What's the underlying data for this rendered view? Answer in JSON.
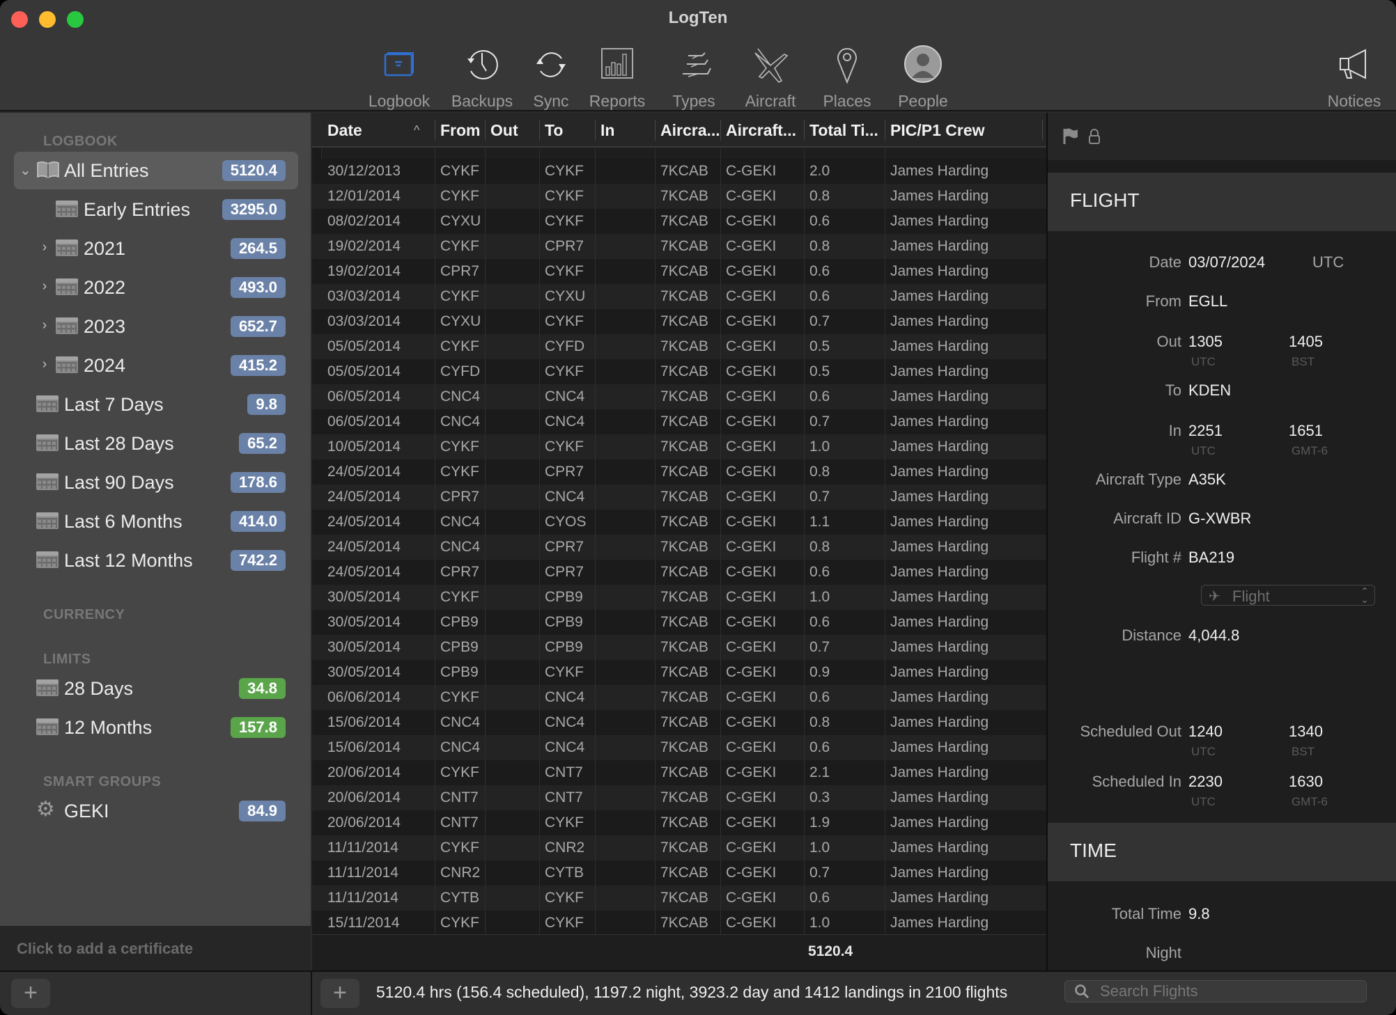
{
  "window": {
    "title": "LogTen"
  },
  "toolbar": {
    "items": [
      {
        "label": "Logbook",
        "icon": "logbook-icon",
        "active": true
      },
      {
        "label": "Backups",
        "icon": "backups-clock-icon"
      },
      {
        "label": "Sync",
        "icon": "sync-icon"
      },
      {
        "label": "Reports",
        "icon": "reports-bar-chart-icon"
      },
      {
        "label": "Types",
        "icon": "types-planes-icon"
      },
      {
        "label": "Aircraft",
        "icon": "aircraft-icon"
      },
      {
        "label": "Places",
        "icon": "places-pin-icon"
      },
      {
        "label": "People",
        "icon": "people-avatar-icon"
      }
    ],
    "notices": {
      "label": "Notices",
      "icon": "megaphone-icon"
    }
  },
  "sidebar": {
    "sections": {
      "logbook": "LOGBOOK",
      "currency": "CURRENCY",
      "limits": "LIMITS",
      "smart_groups": "SMART GROUPS"
    },
    "logbook_items": [
      {
        "label": "All Entries",
        "value": "5120.4",
        "selected": true,
        "expanded": true
      },
      {
        "label": "Early Entries",
        "value": "3295.0"
      },
      {
        "label": "2021",
        "value": "264.5",
        "collapsed": true
      },
      {
        "label": "2022",
        "value": "493.0",
        "collapsed": true
      },
      {
        "label": "2023",
        "value": "652.7",
        "collapsed": true
      },
      {
        "label": "2024",
        "value": "415.2",
        "collapsed": true
      },
      {
        "label": "Last 7 Days",
        "value": "9.8"
      },
      {
        "label": "Last 28 Days",
        "value": "65.2"
      },
      {
        "label": "Last 90 Days",
        "value": "178.6"
      },
      {
        "label": "Last 6 Months",
        "value": "414.0"
      },
      {
        "label": "Last 12 Months",
        "value": "742.2"
      }
    ],
    "limit_items": [
      {
        "label": "28 Days",
        "value": "34.8",
        "status_color": "#5aa54a"
      },
      {
        "label": "12 Months",
        "value": "157.8",
        "status_color": "#5aa54a"
      }
    ],
    "smart_group_items": [
      {
        "label": "GEKI",
        "value": "84.9"
      }
    ],
    "certificate_hint": "Click to add a certificate"
  },
  "table": {
    "columns": [
      "Date",
      "From",
      "Out",
      "To",
      "In",
      "Aircra...",
      "Aircraft...",
      "Total Ti...",
      "PIC/P1 Crew"
    ],
    "sort": {
      "column": "Date",
      "direction": "ascending"
    },
    "rows": [
      [
        "30/12/2013",
        "CYKF",
        "",
        "CYKF",
        "",
        "7KCAB",
        "C-GEKI",
        "2.0",
        "James Harding"
      ],
      [
        "12/01/2014",
        "CYKF",
        "",
        "CYKF",
        "",
        "7KCAB",
        "C-GEKI",
        "0.8",
        "James Harding"
      ],
      [
        "08/02/2014",
        "CYXU",
        "",
        "CYKF",
        "",
        "7KCAB",
        "C-GEKI",
        "0.6",
        "James Harding"
      ],
      [
        "19/02/2014",
        "CYKF",
        "",
        "CPR7",
        "",
        "7KCAB",
        "C-GEKI",
        "0.8",
        "James Harding"
      ],
      [
        "19/02/2014",
        "CPR7",
        "",
        "CYKF",
        "",
        "7KCAB",
        "C-GEKI",
        "0.6",
        "James Harding"
      ],
      [
        "03/03/2014",
        "CYKF",
        "",
        "CYXU",
        "",
        "7KCAB",
        "C-GEKI",
        "0.6",
        "James Harding"
      ],
      [
        "03/03/2014",
        "CYXU",
        "",
        "CYKF",
        "",
        "7KCAB",
        "C-GEKI",
        "0.7",
        "James Harding"
      ],
      [
        "05/05/2014",
        "CYKF",
        "",
        "CYFD",
        "",
        "7KCAB",
        "C-GEKI",
        "0.5",
        "James Harding"
      ],
      [
        "05/05/2014",
        "CYFD",
        "",
        "CYKF",
        "",
        "7KCAB",
        "C-GEKI",
        "0.5",
        "James Harding"
      ],
      [
        "06/05/2014",
        "CNC4",
        "",
        "CNC4",
        "",
        "7KCAB",
        "C-GEKI",
        "0.6",
        "James Harding"
      ],
      [
        "06/05/2014",
        "CNC4",
        "",
        "CNC4",
        "",
        "7KCAB",
        "C-GEKI",
        "0.7",
        "James Harding"
      ],
      [
        "10/05/2014",
        "CYKF",
        "",
        "CYKF",
        "",
        "7KCAB",
        "C-GEKI",
        "1.0",
        "James Harding"
      ],
      [
        "24/05/2014",
        "CYKF",
        "",
        "CPR7",
        "",
        "7KCAB",
        "C-GEKI",
        "0.8",
        "James Harding"
      ],
      [
        "24/05/2014",
        "CPR7",
        "",
        "CNC4",
        "",
        "7KCAB",
        "C-GEKI",
        "0.7",
        "James Harding"
      ],
      [
        "24/05/2014",
        "CNC4",
        "",
        "CYOS",
        "",
        "7KCAB",
        "C-GEKI",
        "1.1",
        "James Harding"
      ],
      [
        "24/05/2014",
        "CNC4",
        "",
        "CPR7",
        "",
        "7KCAB",
        "C-GEKI",
        "0.8",
        "James Harding"
      ],
      [
        "24/05/2014",
        "CPR7",
        "",
        "CPR7",
        "",
        "7KCAB",
        "C-GEKI",
        "0.6",
        "James Harding"
      ],
      [
        "30/05/2014",
        "CYKF",
        "",
        "CPB9",
        "",
        "7KCAB",
        "C-GEKI",
        "1.0",
        "James Harding"
      ],
      [
        "30/05/2014",
        "CPB9",
        "",
        "CPB9",
        "",
        "7KCAB",
        "C-GEKI",
        "0.6",
        "James Harding"
      ],
      [
        "30/05/2014",
        "CPB9",
        "",
        "CPB9",
        "",
        "7KCAB",
        "C-GEKI",
        "0.7",
        "James Harding"
      ],
      [
        "30/05/2014",
        "CPB9",
        "",
        "CYKF",
        "",
        "7KCAB",
        "C-GEKI",
        "0.9",
        "James Harding"
      ],
      [
        "06/06/2014",
        "CYKF",
        "",
        "CNC4",
        "",
        "7KCAB",
        "C-GEKI",
        "0.6",
        "James Harding"
      ],
      [
        "15/06/2014",
        "CNC4",
        "",
        "CNC4",
        "",
        "7KCAB",
        "C-GEKI",
        "0.8",
        "James Harding"
      ],
      [
        "15/06/2014",
        "CNC4",
        "",
        "CNC4",
        "",
        "7KCAB",
        "C-GEKI",
        "0.6",
        "James Harding"
      ],
      [
        "20/06/2014",
        "CYKF",
        "",
        "CNT7",
        "",
        "7KCAB",
        "C-GEKI",
        "2.1",
        "James Harding"
      ],
      [
        "20/06/2014",
        "CNT7",
        "",
        "CNT7",
        "",
        "7KCAB",
        "C-GEKI",
        "0.3",
        "James Harding"
      ],
      [
        "20/06/2014",
        "CNT7",
        "",
        "CYKF",
        "",
        "7KCAB",
        "C-GEKI",
        "1.9",
        "James Harding"
      ],
      [
        "11/11/2014",
        "CYKF",
        "",
        "CNR2",
        "",
        "7KCAB",
        "C-GEKI",
        "1.0",
        "James Harding"
      ],
      [
        "11/11/2014",
        "CNR2",
        "",
        "CYTB",
        "",
        "7KCAB",
        "C-GEKI",
        "0.7",
        "James Harding"
      ],
      [
        "11/11/2014",
        "CYTB",
        "",
        "CYKF",
        "",
        "7KCAB",
        "C-GEKI",
        "0.6",
        "James Harding"
      ],
      [
        "15/11/2014",
        "CYKF",
        "",
        "CYKF",
        "",
        "7KCAB",
        "C-GEKI",
        "1.0",
        "James Harding"
      ]
    ],
    "total_time": "5120.4"
  },
  "detail": {
    "flight_section": "FLIGHT",
    "time_section": "TIME",
    "fields": {
      "date": {
        "label": "Date",
        "value": "03/07/2024",
        "tz": "UTC"
      },
      "from": {
        "label": "From",
        "value": "EGLL"
      },
      "out": {
        "label": "Out",
        "value": "1305",
        "tz": "UTC",
        "local": "1405",
        "local_tz": "BST"
      },
      "to": {
        "label": "To",
        "value": "KDEN"
      },
      "in": {
        "label": "In",
        "value": "2251",
        "tz": "UTC",
        "local": "1651",
        "local_tz": "GMT-6"
      },
      "aircraft_type": {
        "label": "Aircraft Type",
        "value": "A35K"
      },
      "aircraft_id": {
        "label": "Aircraft ID",
        "value": "G-XWBR"
      },
      "flight_number": {
        "label": "Flight #",
        "value": "BA219"
      },
      "flight_kind": {
        "value": "Flight"
      },
      "distance": {
        "label": "Distance",
        "value": "4,044.8"
      },
      "scheduled_out": {
        "label": "Scheduled Out",
        "value": "1240",
        "tz": "UTC",
        "local": "1340",
        "local_tz": "BST"
      },
      "scheduled_in": {
        "label": "Scheduled In",
        "value": "2230",
        "tz": "UTC",
        "local": "1630",
        "local_tz": "GMT-6"
      },
      "total_time": {
        "label": "Total Time",
        "value": "9.8"
      },
      "night": {
        "label": "Night",
        "value": ""
      }
    }
  },
  "footer": {
    "summary": "5120.4 hrs (156.4 scheduled), 1197.2 night, 3923.2 day and 1412 landings in 2100 flights",
    "search_placeholder": "Search Flights"
  },
  "colors": {
    "badge_blue": "#6b82a8",
    "badge_green": "#5aa54a",
    "accent_blue": "#2f6fd0"
  }
}
